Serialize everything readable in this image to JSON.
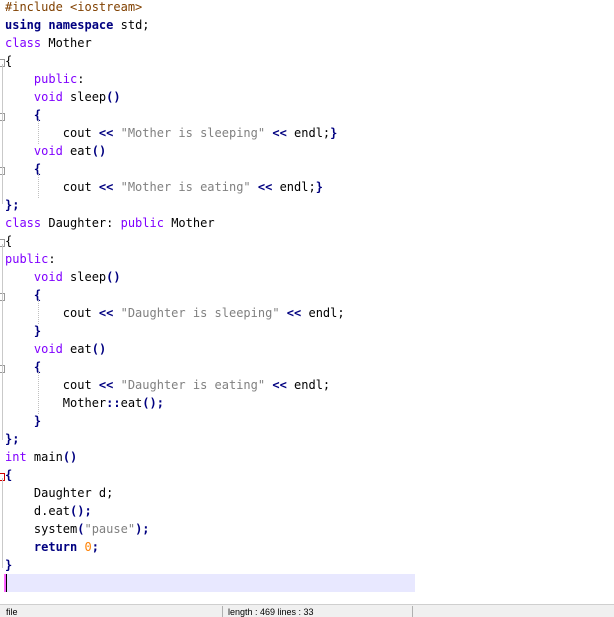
{
  "editor": {
    "lines": [
      [
        [
          "pre",
          "#include <iostream>"
        ]
      ],
      [
        [
          "kw",
          "using"
        ],
        [
          "",
          " "
        ],
        [
          "kw",
          "namespace"
        ],
        [
          "",
          " std;"
        ]
      ],
      [
        [
          "type",
          "class"
        ],
        [
          "",
          " Mother"
        ]
      ],
      [
        [
          "",
          "{"
        ]
      ],
      [
        [
          "",
          "    "
        ],
        [
          "type",
          "public"
        ],
        [
          "",
          ":"
        ]
      ],
      [
        [
          "",
          "    "
        ],
        [
          "type",
          "void"
        ],
        [
          "",
          " sleep"
        ],
        [
          "op",
          "()"
        ]
      ],
      [
        [
          "",
          "    "
        ],
        [
          "op",
          "{"
        ]
      ],
      [
        [
          "",
          "        cout "
        ],
        [
          "op",
          "<<"
        ],
        [
          "",
          " "
        ],
        [
          "str",
          "\"Mother is sleeping\""
        ],
        [
          "",
          " "
        ],
        [
          "op",
          "<<"
        ],
        [
          "",
          " endl;"
        ],
        [
          "op",
          "}"
        ]
      ],
      [
        [
          "",
          "    "
        ],
        [
          "type",
          "void"
        ],
        [
          "",
          " eat"
        ],
        [
          "op",
          "()"
        ]
      ],
      [
        [
          "",
          "    "
        ],
        [
          "op",
          "{"
        ]
      ],
      [
        [
          "",
          "        cout "
        ],
        [
          "op",
          "<<"
        ],
        [
          "",
          " "
        ],
        [
          "str",
          "\"Mother is eating\""
        ],
        [
          "",
          " "
        ],
        [
          "op",
          "<<"
        ],
        [
          "",
          " endl;"
        ],
        [
          "op",
          "}"
        ]
      ],
      [
        [
          "op",
          "};"
        ]
      ],
      [
        [
          "type",
          "class"
        ],
        [
          "",
          " Daughter: "
        ],
        [
          "type",
          "public"
        ],
        [
          "",
          " Mother"
        ]
      ],
      [
        [
          "",
          "{"
        ]
      ],
      [
        [
          "type",
          "public"
        ],
        [
          "",
          ":"
        ]
      ],
      [
        [
          "",
          "    "
        ],
        [
          "type",
          "void"
        ],
        [
          "",
          " sleep"
        ],
        [
          "op",
          "()"
        ]
      ],
      [
        [
          "",
          "    "
        ],
        [
          "op",
          "{"
        ]
      ],
      [
        [
          "",
          "        cout "
        ],
        [
          "op",
          "<<"
        ],
        [
          "",
          " "
        ],
        [
          "str",
          "\"Daughter is sleeping\""
        ],
        [
          "",
          " "
        ],
        [
          "op",
          "<<"
        ],
        [
          "",
          " endl;"
        ]
      ],
      [
        [
          "",
          "    "
        ],
        [
          "op",
          "}"
        ]
      ],
      [
        [
          "",
          "    "
        ],
        [
          "type",
          "void"
        ],
        [
          "",
          " eat"
        ],
        [
          "op",
          "()"
        ]
      ],
      [
        [
          "",
          "    "
        ],
        [
          "op",
          "{"
        ]
      ],
      [
        [
          "",
          "        cout "
        ],
        [
          "op",
          "<<"
        ],
        [
          "",
          " "
        ],
        [
          "str",
          "\"Daughter is eating\""
        ],
        [
          "",
          " "
        ],
        [
          "op",
          "<<"
        ],
        [
          "",
          " endl;"
        ]
      ],
      [
        [
          "",
          "        Mother"
        ],
        [
          "op",
          "::"
        ],
        [
          "",
          "eat"
        ],
        [
          "op",
          "();"
        ]
      ],
      [
        [
          "",
          "    "
        ],
        [
          "op",
          "}"
        ]
      ],
      [
        [
          "op",
          "};"
        ]
      ],
      [
        [
          "type",
          "int"
        ],
        [
          "",
          " main"
        ],
        [
          "op",
          "()"
        ]
      ],
      [
        [
          "op",
          "{"
        ]
      ],
      [
        [
          "",
          "    Daughter d;"
        ]
      ],
      [
        [
          "",
          "    d.eat"
        ],
        [
          "op",
          "();"
        ]
      ],
      [
        [
          "",
          "    system"
        ],
        [
          "op",
          "("
        ],
        [
          "str",
          "\"pause\""
        ],
        [
          "op",
          ");"
        ]
      ],
      [
        [
          "",
          "    "
        ],
        [
          "kw",
          "return"
        ],
        [
          "",
          " "
        ],
        [
          "num",
          "0"
        ],
        [
          "op",
          ";"
        ]
      ],
      [
        [
          "op",
          "}"
        ]
      ],
      [
        [
          "",
          ""
        ]
      ]
    ]
  },
  "statusbar": {
    "left": "file",
    "right": "length : 469    lines : 33"
  }
}
